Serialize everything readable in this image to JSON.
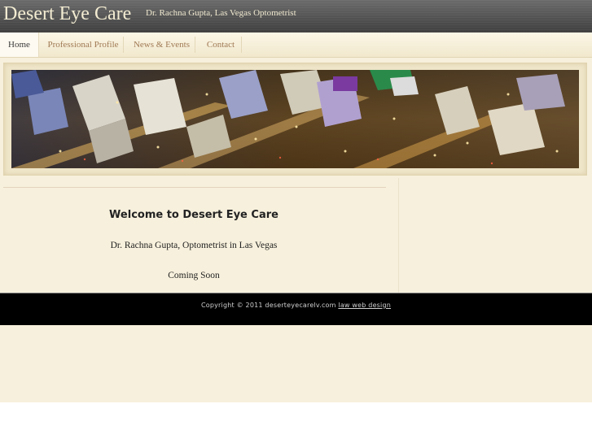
{
  "header": {
    "title": "Desert Eye Care",
    "tagline": "Dr. Rachna Gupta, Las Vegas Optometrist"
  },
  "nav": {
    "items": [
      {
        "label": "Home",
        "active": true
      },
      {
        "label": "Professional Profile",
        "active": false
      },
      {
        "label": "News & Events",
        "active": false
      },
      {
        "label": "Contact",
        "active": false
      }
    ]
  },
  "main": {
    "heading": "Welcome to Desert Eye Care",
    "subheading": "Dr. Rachna Gupta, Optometrist in Las Vegas",
    "status": "Coming Soon"
  },
  "footer": {
    "copyright": "Copyright © 2011 deserteyecarelv.com",
    "link_label": "law web design"
  },
  "colors": {
    "header_bg": "#4a4a4a",
    "page_bg": "#f7f0dc",
    "nav_text": "#a07a55",
    "footer_bg": "#000000"
  }
}
